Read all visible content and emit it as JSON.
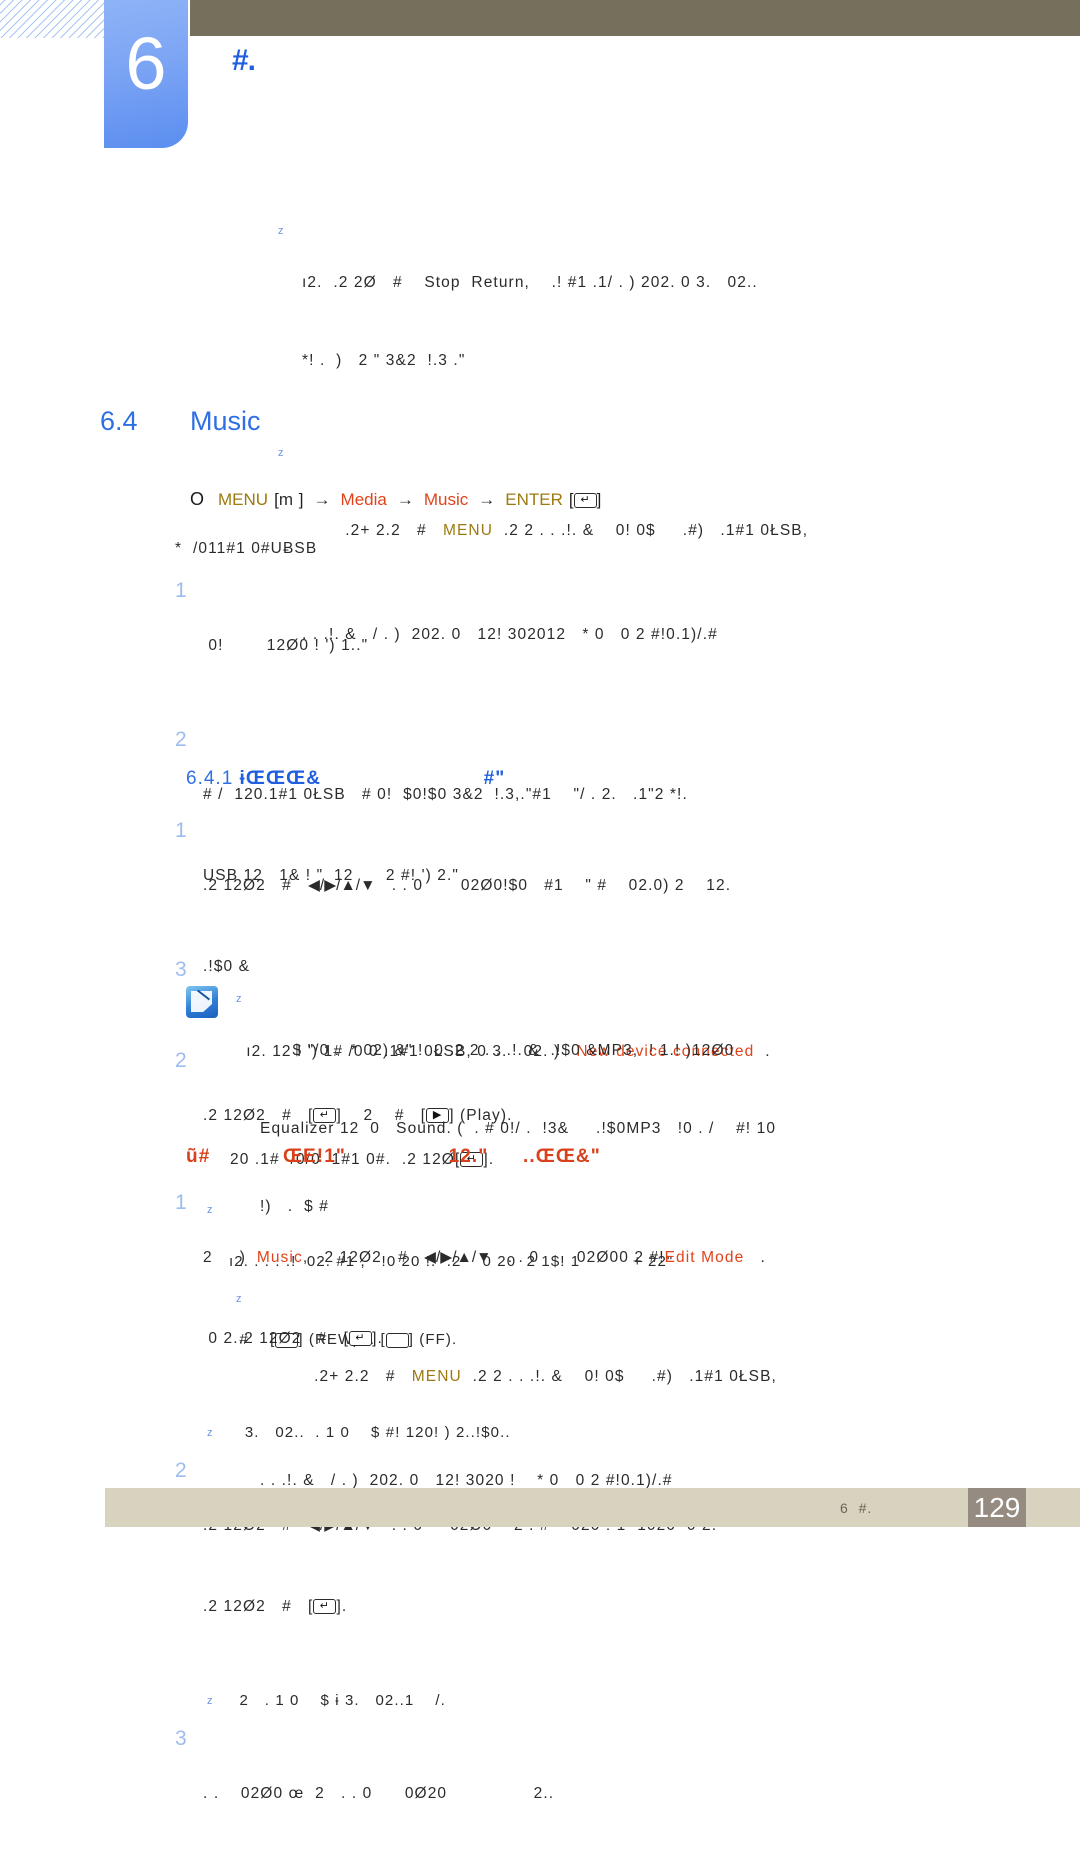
{
  "header": {
    "chapter_number": "6",
    "chapter_title": "#.",
    "hatch_icon": "diagonal-hatch-pattern"
  },
  "top_notes": [
    {
      "bullet": "z",
      "lines": [
        "ı2.  .2 2Ø   #    Stop  Return,    .! #1 .1/ . ) 202. 0 3.   02..",
        "*! .  )   2 \" 3&2  !.3 .\""
      ]
    },
    {
      "bullet": "z",
      "lines": [
        ".2+ 2.2   #   MENU  .2 2 . . .!. &    0! 0$     .#)   .1#1 0ŁSB,",
        ". . .!. &   / . )  202. 0   12! 302012   * 0   0 2 #!0.1)/.#"
      ],
      "highlight": "MENU"
    }
  ],
  "section": {
    "number": "6.4",
    "title": "Music"
  },
  "menu_path": {
    "marker": "O",
    "menu_label": "MENU",
    "menu_key": "m",
    "arrow": "→",
    "media_label": "Media",
    "music_label": "Music",
    "enter_label": "ENTER",
    "enter_key": "enter-key-icon"
  },
  "intro_line": "*  /011#1 0#UɃSB",
  "steps_1": [
    {
      "num": "1",
      "lines": [
        " 0!        12Ø0 ! ') 1..\""
      ]
    },
    {
      "num": "2",
      "lines": [
        "# /  120.1#1 0ŁSB   # 0!  $0!$0 3&2  !.3,.\"#1    \"/ . 2.   .1\"2 *!.",
        "USB 12   1& ! \"  12      2 #! ') 2.\""
      ]
    },
    {
      "num": "3",
      "lines": [
        "ı2. 12 ! ') 1# /0 0 .1#1 0ŁSB, 0 3.   02. )   New device connected  .",
        "20 .1#  /0/0  1#1 0#.  .2 12Ø[enter].",
        ""
      ],
      "highlight": "New device connected"
    }
  ],
  "sub_heading_1": {
    "number": "6.4.1",
    "text_a": "ɨŒŒŒ&",
    "text_b": "#\""
  },
  "steps_2": [
    {
      "num": "1",
      "lines": [
        ".2 12Ø2   #   ◀/▶/▲/▼   . . 0       02Ø0!$0   #1    \" #    02.0) 2    12.",
        ".!$0 &"
      ]
    },
    {
      "num": "2",
      "lines": [
        ".2 12Ø2   #   [enter]    2    #   [play] (Play)."
      ]
    }
  ],
  "sub_note_2": {
    "bullet": "z",
    "lines": [
      "ı2. . . . .!  02. #1 ,   !0 20 !.  .2    0 20  2 1$! 1          + 22\"",
      "#    [rew] (REW)  . [ff] (FF)."
    ]
  },
  "note_box": {
    "icon": "note-pencil-icon",
    "notes": [
      {
        "bullet": "z",
        "lines": [
          "      $ \"/0 .  * 02) &\" !  0 .2 2 . . .!. &  .!$0 &MP3,  ! 1.! )12Ø0",
          "Equalizer 12  0   Sound. (  . # 0!/ .  !3&     .!$0MP3   !0 . /    #! 10",
          "!)   .  $ #"
        ],
        "highlights": [
          "Equalizer",
          "Sound",
          "MP3"
        ]
      },
      {
        "bullet": "z",
        "lines": [
          ".2+ 2.2   #   MENU  .2 2 . . .!. &    0! 0$     .#)   .1#1 0ŁSB,",
          ". . .!. &   / . )  202. 0   12! 3020 !    * 0   0 2 #!0.1)/.#"
        ],
        "highlight": "MENU"
      }
    ]
  },
  "sub_heading_2": {
    "text_a": "ũ#",
    "text_b": "ŒE!1\"",
    "text_c": "12.\"",
    "text_d": "..ŒŒ&\""
  },
  "steps_3": [
    {
      "num": "1",
      "lines": [
        "2     )  Music,  .2 12Ø2   #   ◀/▶/▲/▼   . . 0       02Ø00 2 #!Edit Mode   .",
        " 0 2..2 12Ø2   #   [enter]."
      ],
      "highlights": [
        "Music",
        "Edit Mode"
      ]
    },
    {
      "sub_bullet": "z",
      "lines": [
        "   3.   02..  . 1 0    $ #! 120! ) 2..!$0.."
      ]
    },
    {
      "num": "2",
      "lines": [
        ".2 12Ø2   #   ◀/▶/▲/▼   . . 0     02Ø0    2 . #    020 ! 1  1020  0 2.",
        ".2 12Ø2   #   [enter]."
      ]
    },
    {
      "sub_bullet": "z",
      "lines": [
        "  2   . 1 0    $ ɨ 3.   02..1    /."
      ]
    },
    {
      "num": "3",
      "lines": [
        ". .    02Ø0 œ  2   . . 0      0Ø20                2.."
      ]
    }
  ],
  "footer": {
    "chapter_label": "6  #.",
    "page_number": "129"
  },
  "colors": {
    "chapter_tab_blue": "#7ba4f4",
    "brown_bar": "#74705c",
    "heading_blue": "#2f6fe4",
    "accent_orange": "#d8411b",
    "accent_olive": "#9c7a10",
    "footer_bar": "#d8d3bf",
    "page_box": "#958b80",
    "step_number_blue": "#9dbcf0"
  }
}
